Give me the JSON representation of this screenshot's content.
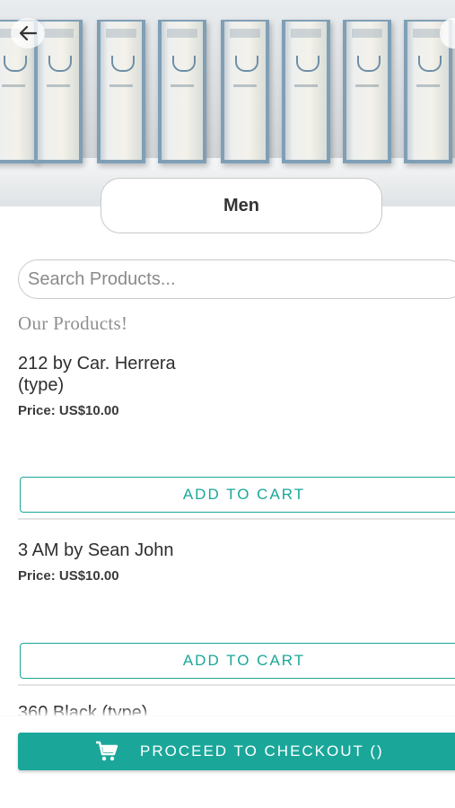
{
  "header": {
    "back_icon": "arrow-left-icon",
    "category": "Men"
  },
  "search": {
    "placeholder": "Search Products...",
    "value": ""
  },
  "section_title": "Our Products!",
  "products": [
    {
      "name": "212 by Car. Herrera (type)",
      "price": "Price: US$10.00",
      "button_label": "ADD TO CART"
    },
    {
      "name": "3 AM by Sean John",
      "price": "Price: US$10.00",
      "button_label": "ADD TO CART"
    },
    {
      "name": "360 Black (type)"
    }
  ],
  "footer": {
    "checkout_icon": "cart-icon",
    "checkout_label": "PROCEED TO CHECKOUT ()"
  },
  "colors": {
    "accent": "#1aa79a",
    "text": "#2e2e2e",
    "muted": "#8f8f8f"
  }
}
